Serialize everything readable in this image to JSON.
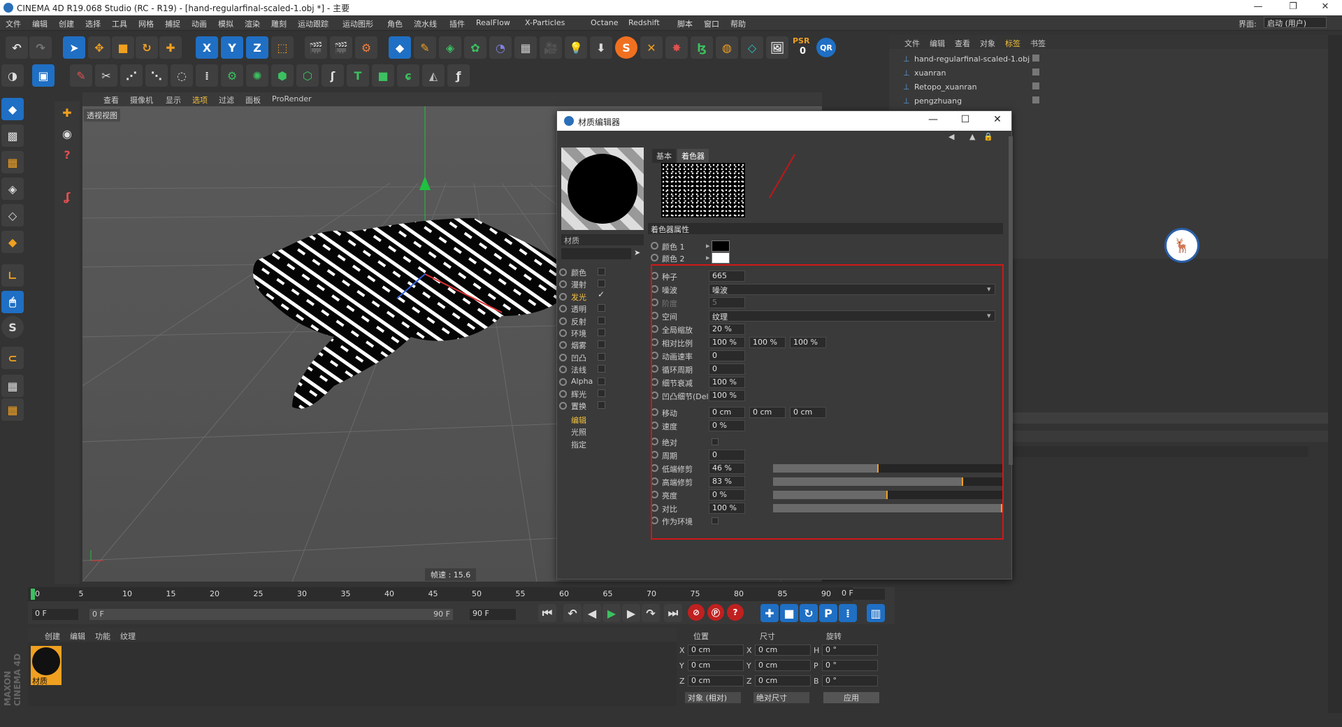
{
  "window": {
    "title": "CINEMA 4D R19.068 Studio (RC - R19) - [hand-regularfinal-scaled-1.obj *] - 主要",
    "right_label": "界面:",
    "layout": "启动 (用户)"
  },
  "menu": [
    "文件",
    "编辑",
    "创建",
    "选择",
    "工具",
    "网格",
    "捕捉",
    "动画",
    "模拟",
    "渲染",
    "雕刻",
    "运动跟踪",
    "运动图形",
    "角色",
    "流水线",
    "插件",
    "RealFlow",
    "X-Particles",
    "Octane",
    "Redshift",
    "脚本",
    "窗口",
    "帮助"
  ],
  "toolbar_text": {
    "psr": "PSR",
    "psr_val": "0",
    "qr": "QR"
  },
  "viewport": {
    "menu": [
      "查看",
      "摄像机",
      "显示",
      "选项",
      "过滤",
      "面板",
      "ProRender"
    ],
    "label": "透视视图",
    "fps": "帧速 : 15.6"
  },
  "material_editor": {
    "title": "材质编辑器",
    "preview_label": "材质",
    "tabs": [
      "基本",
      "着色器"
    ],
    "section": "着色器属性",
    "channels": [
      {
        "label": "颜色",
        "checked": false
      },
      {
        "label": "漫射",
        "checked": false
      },
      {
        "label": "发光",
        "checked": true
      },
      {
        "label": "透明",
        "checked": false
      },
      {
        "label": "反射",
        "checked": false
      },
      {
        "label": "环境",
        "checked": false
      },
      {
        "label": "烟雾",
        "checked": false
      },
      {
        "label": "凹凸",
        "checked": false
      },
      {
        "label": "法线",
        "checked": false
      },
      {
        "label": "Alpha",
        "checked": false
      },
      {
        "label": "辉光",
        "checked": false
      },
      {
        "label": "置换",
        "checked": false
      }
    ],
    "subitems": [
      "编辑",
      "光照",
      "指定"
    ],
    "color1": "颜色 1",
    "color2": "颜色 2",
    "params": [
      {
        "label": "种子",
        "values": [
          "665"
        ]
      },
      {
        "label": "噪波",
        "values": [
          "噪波"
        ]
      },
      {
        "label": "阶度",
        "values": [
          "5"
        ]
      },
      {
        "label": "空间",
        "values": [
          "纹理"
        ]
      },
      {
        "label": "全局缩放",
        "values": [
          "20 %"
        ]
      },
      {
        "label": "相对比例",
        "values": [
          "100 %",
          "100 %",
          "100 %"
        ]
      },
      {
        "label": "动画速率",
        "values": [
          "0"
        ]
      },
      {
        "label": "循环周期",
        "values": [
          "0"
        ]
      },
      {
        "label": "细节衰减",
        "values": [
          "100 %"
        ]
      },
      {
        "label": "凹凸细节(Delta)",
        "values": [
          "100 %"
        ]
      },
      {
        "label": "移动",
        "values": [
          "0 cm",
          "0 cm",
          "0 cm"
        ]
      },
      {
        "label": "速度",
        "values": [
          "0 %"
        ]
      },
      {
        "label": "绝对",
        "values": [
          ""
        ]
      },
      {
        "label": "周期",
        "values": [
          "0"
        ]
      },
      {
        "label": "低端修剪",
        "values": [
          "46 %"
        ],
        "level": 0.46
      },
      {
        "label": "高端修剪",
        "values": [
          "83 %"
        ],
        "level": 0.83
      },
      {
        "label": "亮度",
        "values": [
          "0 %"
        ],
        "level": 0.5
      },
      {
        "label": "对比",
        "values": [
          "100 %"
        ],
        "level": 1.0
      },
      {
        "label": "作为环境",
        "values": [
          ""
        ]
      }
    ]
  },
  "object_manager": {
    "menu": [
      "文件",
      "编辑",
      "查看",
      "对象",
      "标签",
      "书签"
    ],
    "objects": [
      "hand-regularfinal-scaled-1.obj",
      "xuanran",
      "Retopo_xuanran",
      "pengzhuang"
    ]
  },
  "timeline": {
    "ticks": [
      "0",
      "5",
      "10",
      "15",
      "20",
      "25",
      "30",
      "35",
      "40",
      "45",
      "50",
      "55",
      "60",
      "65",
      "70",
      "75",
      "80",
      "85",
      "90"
    ],
    "frame_end": "0 F",
    "start": "0 F",
    "range_start": "0 F",
    "range_end": "90 F",
    "end": "90 F"
  },
  "material_manager": {
    "menu": [
      "创建",
      "编辑",
      "功能",
      "纹理"
    ],
    "item": "材质"
  },
  "coords": {
    "headers": [
      "位置",
      "尺寸",
      "旋转"
    ],
    "rows": [
      [
        "X",
        "0 cm",
        "X",
        "0 cm",
        "H",
        "0 °"
      ],
      [
        "Y",
        "0 cm",
        "Y",
        "0 cm",
        "P",
        "0 °"
      ],
      [
        "Z",
        "0 cm",
        "Z",
        "0 cm",
        "B",
        "0 °"
      ]
    ],
    "mode": "对象 (相对)",
    "size_mode": "绝对尺寸",
    "apply": "应用"
  },
  "branding": "MAXON CINEMA 4D"
}
